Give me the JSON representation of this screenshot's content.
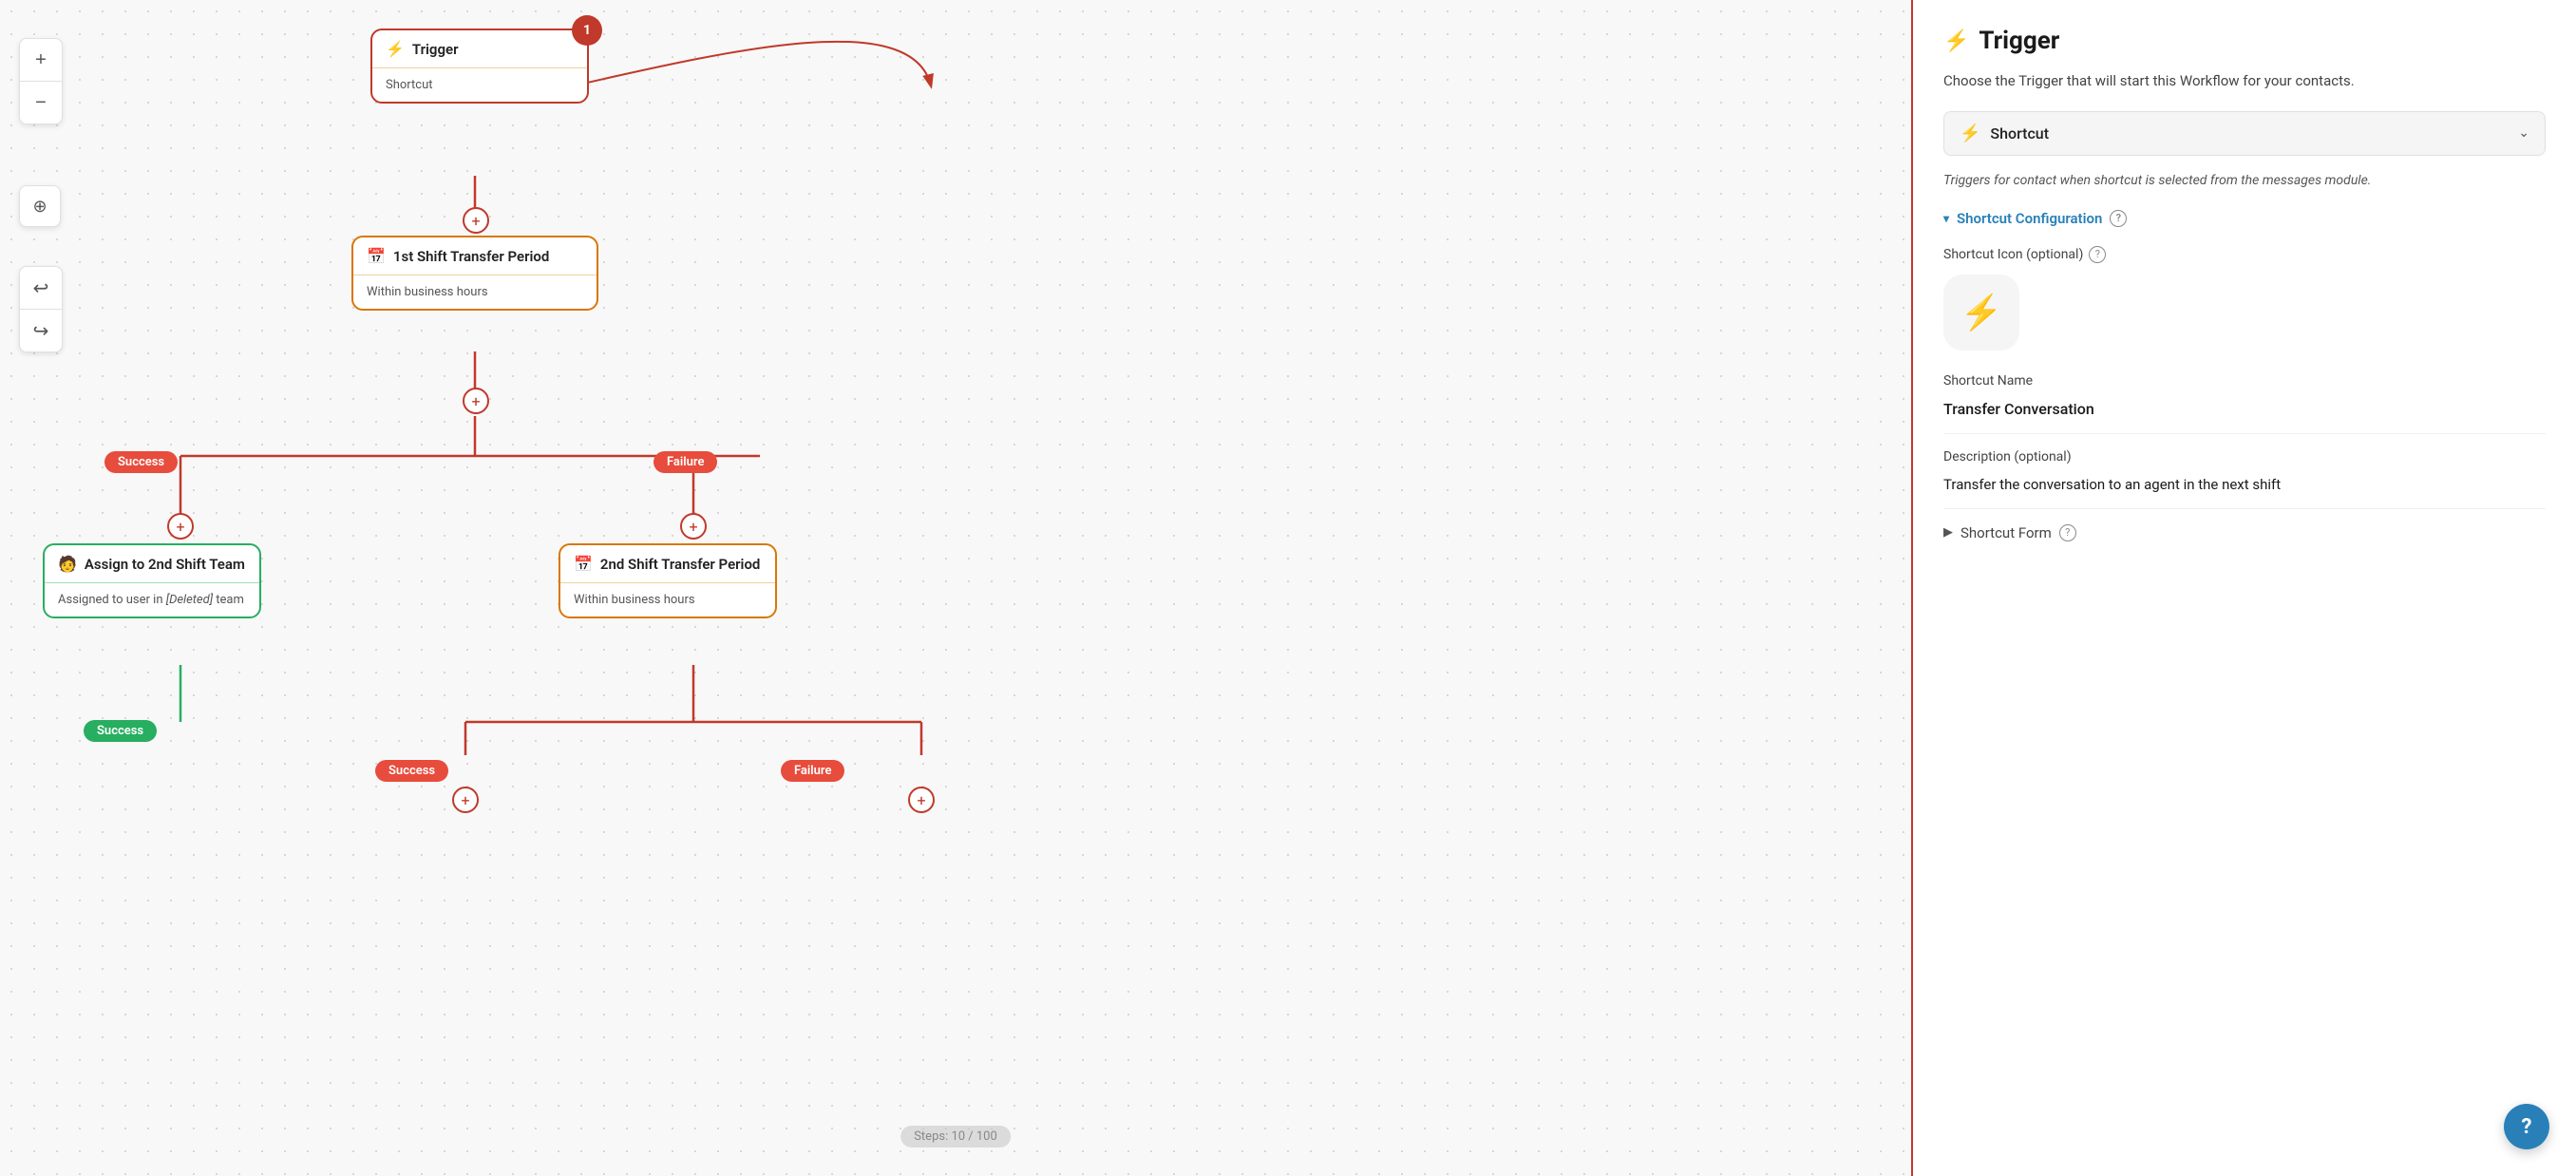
{
  "canvas": {
    "steps_label": "Steps: 10 / 100"
  },
  "zoom_controls": {
    "plus_label": "+",
    "minus_label": "−",
    "target_label": "⊕",
    "undo_label": "↩",
    "redo_label": "↪"
  },
  "nodes": {
    "trigger": {
      "title": "Trigger",
      "value": "Shortcut",
      "badge": "1"
    },
    "shift1": {
      "title": "1st Shift Transfer Period",
      "value": "Within business hours"
    },
    "shift2": {
      "title": "2nd Shift Transfer Period",
      "value": "Within business hours"
    },
    "assign": {
      "title": "Assign to 2nd Shift Team",
      "value": "Assigned to user in [Deleted] team"
    }
  },
  "labels": {
    "success1": "Success",
    "failure1": "Failure",
    "success2": "Success",
    "failure2": "Failure",
    "success3": "Success"
  },
  "panel": {
    "title": "Trigger",
    "description": "Choose the Trigger that will start this Workflow for your contacts.",
    "dropdown": {
      "label": "Shortcut",
      "chevron": "⌄"
    },
    "trigger_desc": "Triggers for contact when shortcut is selected from the messages module.",
    "shortcut_config_label": "Shortcut Configuration",
    "shortcut_icon_label": "Shortcut Icon (optional)",
    "shortcut_name_label": "Shortcut Name",
    "shortcut_name_value": "Transfer Conversation",
    "description_label": "Description (optional)",
    "description_value": "Transfer the conversation to an agent in the next shift",
    "shortcut_form_label": "Shortcut Form"
  }
}
